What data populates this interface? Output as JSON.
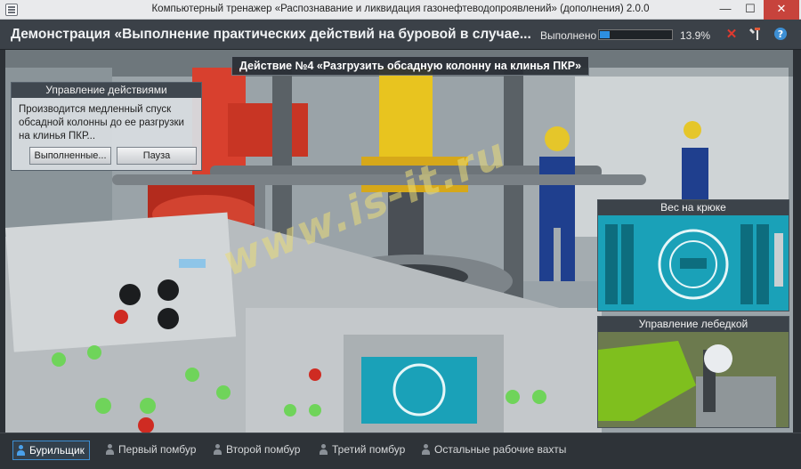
{
  "window": {
    "title": "Компьютерный тренажер «Распознавание и ликвидация газонефтеводопроявлений» (дополнения) 2.0.0",
    "minimize": "—",
    "maximize": "☐",
    "close": "✕"
  },
  "header": {
    "demo_title": "Демонстрация «Выполнение практических действий на буровой в случае...",
    "progress_label": "Выполнено",
    "progress_value": "13.9%",
    "progress_fraction": 0.139,
    "icons": [
      "close-icon",
      "tools-icon",
      "help-icon"
    ]
  },
  "action_banner": "Действие №4 «Разгрузить обсадную колонну на клинья ПКР»",
  "control_panel": {
    "title": "Управление действиями",
    "text": "Производится медленный спуск обсадной колонны до ее разгрузки на клинья ПКР...",
    "done_button": "Выполненные...",
    "pause_button": "Пауза"
  },
  "right_panels": {
    "hook_weight": "Вес на крюке",
    "winch_control": "Управление лебедкой"
  },
  "watermark": "www.is-it.ru",
  "bottom_tabs": [
    {
      "label": "Бурильщик",
      "active": true
    },
    {
      "label": "Первый помбур",
      "active": false
    },
    {
      "label": "Второй помбур",
      "active": false
    },
    {
      "label": "Третий помбур",
      "active": false
    },
    {
      "label": "Остальные рабочие вахты",
      "active": false
    }
  ],
  "colors": {
    "accent": "#3d8fd4",
    "close_red": "#e0392f",
    "progress": "#2d8fe0"
  }
}
